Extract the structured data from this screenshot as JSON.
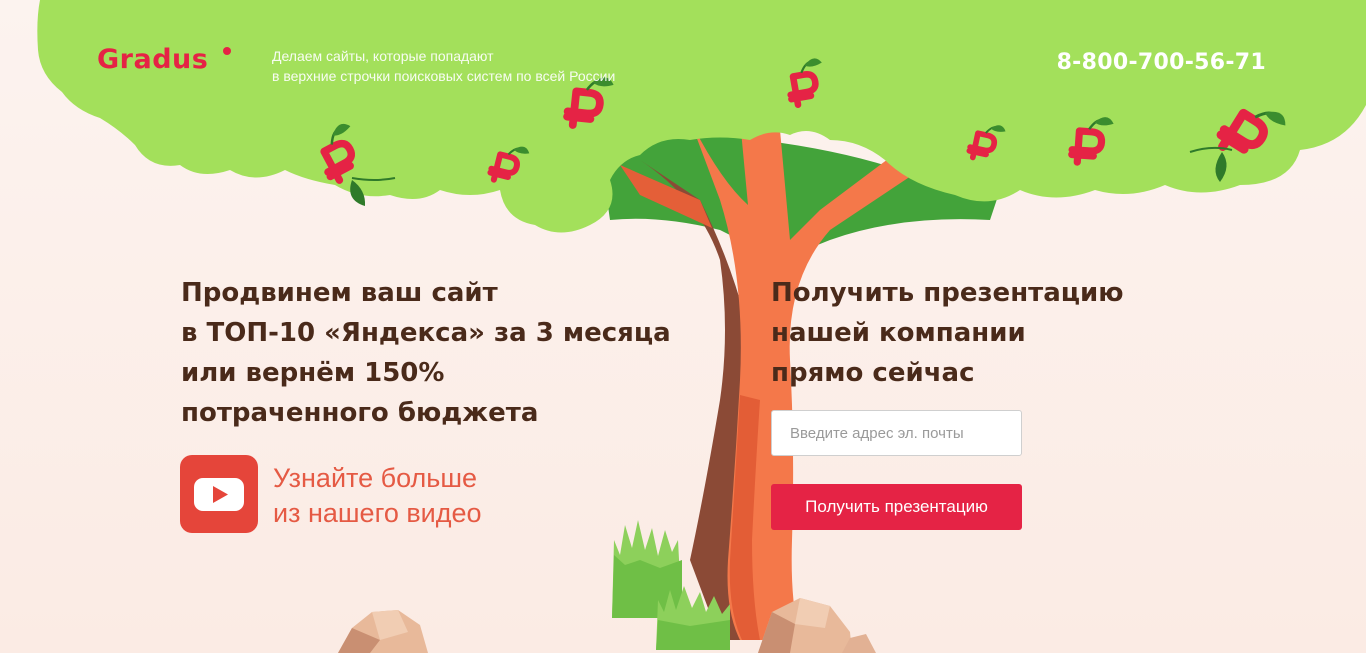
{
  "header": {
    "logo_text": "Gradus",
    "tagline_lines": [
      "Делаем сайты, которые попадают",
      "в верхние строчки поисковых систем по всей России"
    ],
    "phone": "8-800-700-56-71"
  },
  "hero": {
    "headline_lines": [
      "Продвинем ваш сайт",
      "в ТОП-10 «Яндекса» за 3 месяца",
      "или вернём 150%",
      "потраченного бюджета"
    ],
    "video_link_lines": [
      "Узнайте больше",
      "из нашего видео"
    ],
    "video_icon": "youtube-play-icon"
  },
  "form": {
    "title_lines": [
      "Получить презентацию",
      "нашей компании",
      "прямо сейчас"
    ],
    "email_placeholder": "Введите адрес эл. почты",
    "email_value": "",
    "submit_label": "Получить презентацию"
  },
  "colors": {
    "brand_red": "#e52345",
    "foliage_green": "#a3e05b",
    "trunk_orange": "#f4784a",
    "text_brown": "#4a2a1a",
    "video_link": "#e55a44",
    "background": "#fcf3ef"
  },
  "decor": {
    "ruble_fruit_icon": "ruble-fruit-icon",
    "tree_icon": "money-tree-illustration",
    "rock_icon": "rock-icon",
    "grass_icon": "grass-icon"
  }
}
